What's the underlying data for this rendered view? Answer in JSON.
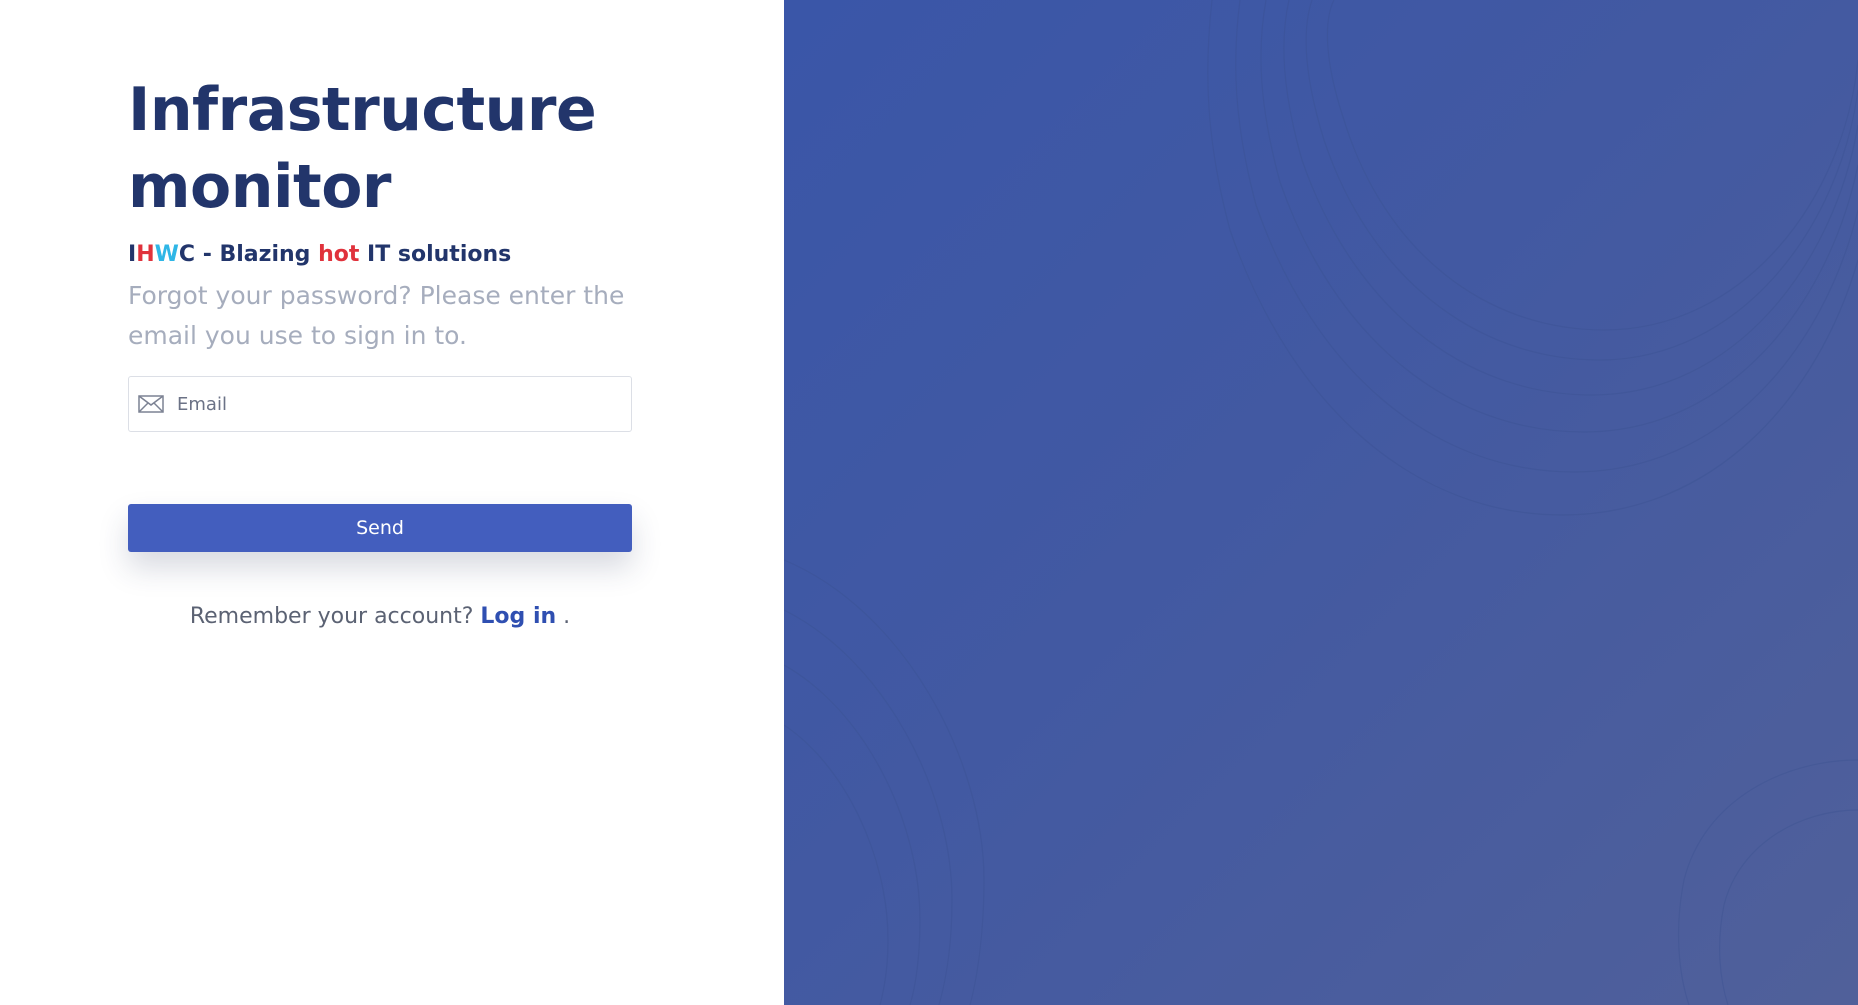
{
  "app": {
    "title": "Infrastructure monitor"
  },
  "tagline": {
    "letter_i": "I",
    "letter_h": "H",
    "letter_w": "W",
    "letter_c": "C",
    "separator": " - Blazing ",
    "hot": "hot",
    "rest": " IT solutions"
  },
  "instructions": "Forgot your password? Please enter the email you use to sign in to.",
  "email_field": {
    "icon": "envelope-icon",
    "placeholder": "Email",
    "value": ""
  },
  "send_button": {
    "label": "Send"
  },
  "login_prompt": {
    "text": "Remember your account?",
    "link_label": "Log in",
    "suffix": "."
  },
  "colors": {
    "title": "#22356b",
    "accent_red": "#e0323c",
    "accent_cyan": "#2fb6e6",
    "button": "#435ebe",
    "link": "#2f4fb1",
    "right_panel": "#4259a2"
  }
}
